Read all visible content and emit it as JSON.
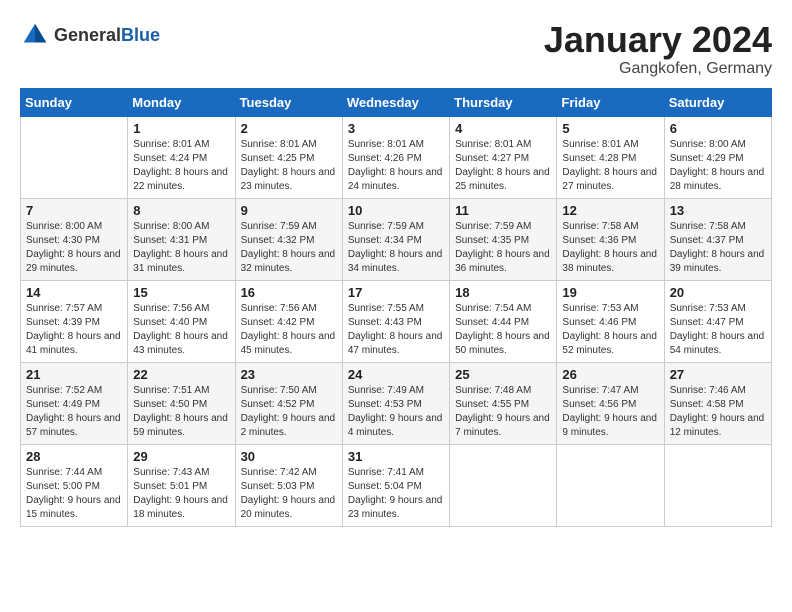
{
  "header": {
    "logo_general": "General",
    "logo_blue": "Blue",
    "month_year": "January 2024",
    "location": "Gangkofen, Germany"
  },
  "days_of_week": [
    "Sunday",
    "Monday",
    "Tuesday",
    "Wednesday",
    "Thursday",
    "Friday",
    "Saturday"
  ],
  "weeks": [
    [
      {
        "day": "",
        "sunrise": "",
        "sunset": "",
        "daylight": ""
      },
      {
        "day": "1",
        "sunrise": "Sunrise: 8:01 AM",
        "sunset": "Sunset: 4:24 PM",
        "daylight": "Daylight: 8 hours and 22 minutes."
      },
      {
        "day": "2",
        "sunrise": "Sunrise: 8:01 AM",
        "sunset": "Sunset: 4:25 PM",
        "daylight": "Daylight: 8 hours and 23 minutes."
      },
      {
        "day": "3",
        "sunrise": "Sunrise: 8:01 AM",
        "sunset": "Sunset: 4:26 PM",
        "daylight": "Daylight: 8 hours and 24 minutes."
      },
      {
        "day": "4",
        "sunrise": "Sunrise: 8:01 AM",
        "sunset": "Sunset: 4:27 PM",
        "daylight": "Daylight: 8 hours and 25 minutes."
      },
      {
        "day": "5",
        "sunrise": "Sunrise: 8:01 AM",
        "sunset": "Sunset: 4:28 PM",
        "daylight": "Daylight: 8 hours and 27 minutes."
      },
      {
        "day": "6",
        "sunrise": "Sunrise: 8:00 AM",
        "sunset": "Sunset: 4:29 PM",
        "daylight": "Daylight: 8 hours and 28 minutes."
      }
    ],
    [
      {
        "day": "7",
        "sunrise": "Sunrise: 8:00 AM",
        "sunset": "Sunset: 4:30 PM",
        "daylight": "Daylight: 8 hours and 29 minutes."
      },
      {
        "day": "8",
        "sunrise": "Sunrise: 8:00 AM",
        "sunset": "Sunset: 4:31 PM",
        "daylight": "Daylight: 8 hours and 31 minutes."
      },
      {
        "day": "9",
        "sunrise": "Sunrise: 7:59 AM",
        "sunset": "Sunset: 4:32 PM",
        "daylight": "Daylight: 8 hours and 32 minutes."
      },
      {
        "day": "10",
        "sunrise": "Sunrise: 7:59 AM",
        "sunset": "Sunset: 4:34 PM",
        "daylight": "Daylight: 8 hours and 34 minutes."
      },
      {
        "day": "11",
        "sunrise": "Sunrise: 7:59 AM",
        "sunset": "Sunset: 4:35 PM",
        "daylight": "Daylight: 8 hours and 36 minutes."
      },
      {
        "day": "12",
        "sunrise": "Sunrise: 7:58 AM",
        "sunset": "Sunset: 4:36 PM",
        "daylight": "Daylight: 8 hours and 38 minutes."
      },
      {
        "day": "13",
        "sunrise": "Sunrise: 7:58 AM",
        "sunset": "Sunset: 4:37 PM",
        "daylight": "Daylight: 8 hours and 39 minutes."
      }
    ],
    [
      {
        "day": "14",
        "sunrise": "Sunrise: 7:57 AM",
        "sunset": "Sunset: 4:39 PM",
        "daylight": "Daylight: 8 hours and 41 minutes."
      },
      {
        "day": "15",
        "sunrise": "Sunrise: 7:56 AM",
        "sunset": "Sunset: 4:40 PM",
        "daylight": "Daylight: 8 hours and 43 minutes."
      },
      {
        "day": "16",
        "sunrise": "Sunrise: 7:56 AM",
        "sunset": "Sunset: 4:42 PM",
        "daylight": "Daylight: 8 hours and 45 minutes."
      },
      {
        "day": "17",
        "sunrise": "Sunrise: 7:55 AM",
        "sunset": "Sunset: 4:43 PM",
        "daylight": "Daylight: 8 hours and 47 minutes."
      },
      {
        "day": "18",
        "sunrise": "Sunrise: 7:54 AM",
        "sunset": "Sunset: 4:44 PM",
        "daylight": "Daylight: 8 hours and 50 minutes."
      },
      {
        "day": "19",
        "sunrise": "Sunrise: 7:53 AM",
        "sunset": "Sunset: 4:46 PM",
        "daylight": "Daylight: 8 hours and 52 minutes."
      },
      {
        "day": "20",
        "sunrise": "Sunrise: 7:53 AM",
        "sunset": "Sunset: 4:47 PM",
        "daylight": "Daylight: 8 hours and 54 minutes."
      }
    ],
    [
      {
        "day": "21",
        "sunrise": "Sunrise: 7:52 AM",
        "sunset": "Sunset: 4:49 PM",
        "daylight": "Daylight: 8 hours and 57 minutes."
      },
      {
        "day": "22",
        "sunrise": "Sunrise: 7:51 AM",
        "sunset": "Sunset: 4:50 PM",
        "daylight": "Daylight: 8 hours and 59 minutes."
      },
      {
        "day": "23",
        "sunrise": "Sunrise: 7:50 AM",
        "sunset": "Sunset: 4:52 PM",
        "daylight": "Daylight: 9 hours and 2 minutes."
      },
      {
        "day": "24",
        "sunrise": "Sunrise: 7:49 AM",
        "sunset": "Sunset: 4:53 PM",
        "daylight": "Daylight: 9 hours and 4 minutes."
      },
      {
        "day": "25",
        "sunrise": "Sunrise: 7:48 AM",
        "sunset": "Sunset: 4:55 PM",
        "daylight": "Daylight: 9 hours and 7 minutes."
      },
      {
        "day": "26",
        "sunrise": "Sunrise: 7:47 AM",
        "sunset": "Sunset: 4:56 PM",
        "daylight": "Daylight: 9 hours and 9 minutes."
      },
      {
        "day": "27",
        "sunrise": "Sunrise: 7:46 AM",
        "sunset": "Sunset: 4:58 PM",
        "daylight": "Daylight: 9 hours and 12 minutes."
      }
    ],
    [
      {
        "day": "28",
        "sunrise": "Sunrise: 7:44 AM",
        "sunset": "Sunset: 5:00 PM",
        "daylight": "Daylight: 9 hours and 15 minutes."
      },
      {
        "day": "29",
        "sunrise": "Sunrise: 7:43 AM",
        "sunset": "Sunset: 5:01 PM",
        "daylight": "Daylight: 9 hours and 18 minutes."
      },
      {
        "day": "30",
        "sunrise": "Sunrise: 7:42 AM",
        "sunset": "Sunset: 5:03 PM",
        "daylight": "Daylight: 9 hours and 20 minutes."
      },
      {
        "day": "31",
        "sunrise": "Sunrise: 7:41 AM",
        "sunset": "Sunset: 5:04 PM",
        "daylight": "Daylight: 9 hours and 23 minutes."
      },
      {
        "day": "",
        "sunrise": "",
        "sunset": "",
        "daylight": ""
      },
      {
        "day": "",
        "sunrise": "",
        "sunset": "",
        "daylight": ""
      },
      {
        "day": "",
        "sunrise": "",
        "sunset": "",
        "daylight": ""
      }
    ]
  ]
}
